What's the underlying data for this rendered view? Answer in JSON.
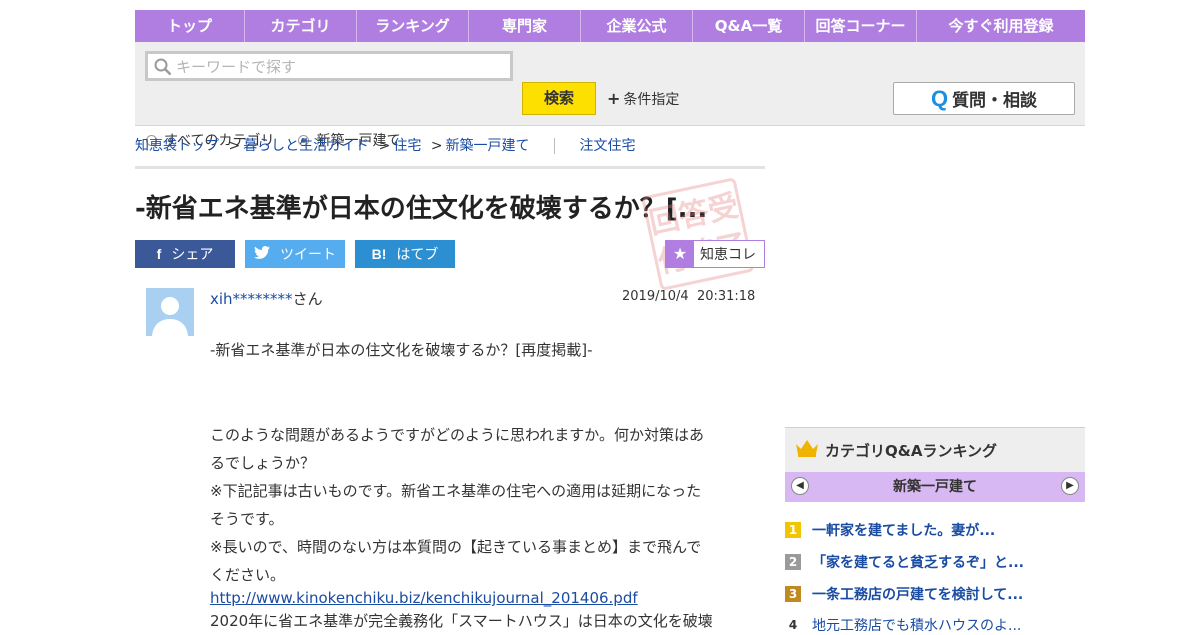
{
  "nav": {
    "items": [
      "トップ",
      "カテゴリ",
      "ランキング",
      "専門家",
      "企業公式",
      "Q&A一覧",
      "回答コーナー",
      "今すぐ利用登録"
    ]
  },
  "search": {
    "placeholder": "キーワードで探す",
    "submit_label": "検索",
    "conditions_label": "条件指定",
    "ask_label": "質問・相談",
    "ask_icon_letter": "Q",
    "scope_all": "すべてのカテゴリ",
    "scope_current": "新築一戸建て",
    "selected_scope": "新築一戸建て"
  },
  "breadcrumb": {
    "items": [
      "知恵袋トップ",
      "暮らしと生活ガイド",
      "住宅",
      "新築一戸建て"
    ],
    "separator": ">",
    "related": "注文住宅"
  },
  "question": {
    "title": "-新省エネ基準が日本の住文化を破壊するか？[...",
    "stamp_text": "回答受付終了",
    "user": "xih********",
    "user_suffix": "さん",
    "date": "2019/10/4",
    "time": "20:31:18",
    "lines": [
      "-新省エネ基準が日本の住文化を破壊するか？[再度掲載]-",
      "このような問題があるようですがどのように思われますか。何か対策はあ",
      "るでしょうか？",
      "※下記記事は古いものです。新省エネ基準の住宅への適用は延期になった",
      "そうです。",
      "※長いので、時間のない方は本質問の【起きている事まとめ】まで飛んで",
      "ください。",
      "2020年に省エネ基準が完全義務化「スマートハウス」は日本の文化を破壊"
    ],
    "link": "http://www.kinokenchiku.biz/kenchikujournal_201406.pdf"
  },
  "share": {
    "facebook": "シェア",
    "twitter": "ツイート",
    "hatena": "はてブ",
    "hatena_icon": "B!",
    "chiekore": "知恵コレ"
  },
  "ranking": {
    "title": "カテゴリQ&Aランキング",
    "category": "新築一戸建て",
    "items": [
      {
        "no": "1",
        "title": "一軒家を建てました。妻が...",
        "color": "#f2c500"
      },
      {
        "no": "2",
        "title": "「家を建てると貧乏するぞ」と...",
        "color": "#9a9a9a"
      },
      {
        "no": "3",
        "title": "一条工務店の戸建てを検討して...",
        "color": "#c08a20"
      },
      {
        "no": "4",
        "title": "地元工務店でも積水ハウスのよ...",
        "color": "#ffffff"
      }
    ]
  }
}
